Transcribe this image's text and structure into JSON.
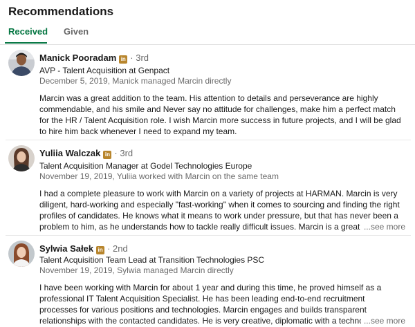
{
  "section": {
    "title": "Recommendations"
  },
  "tabs": [
    {
      "label": "Received",
      "active": true
    },
    {
      "label": "Given",
      "active": false
    }
  ],
  "recommendations": [
    {
      "name": "Manick Pooradam",
      "badge": "in",
      "degree": "3rd",
      "headline": "AVP - Talent Acquisition at Genpact",
      "meta": "December 5, 2019, Manick managed Marcin directly",
      "text": "Marcin was a great addition to the team. His attention to details and perseverance are highly commendable, and his smile and Never say no attitude for challenges, make him a perfect match for the HR / Talent Acquisition role. I wish Marcin more success in future projects, and I will be glad to hire him back whenever I need to expand my team.",
      "see_more": ""
    },
    {
      "name": "Yuliia Walczak",
      "badge": "in",
      "degree": "3rd",
      "headline": "Talent Acquisition Manager at Godel Technologies Europe",
      "meta": "November 19, 2019, Yuliia worked with Marcin on the same team",
      "text": "I had a complete pleasure to work with Marcin on a variety of projects at HARMAN. Marcin is very diligent, hard-working and especially \"fast-working\" when it comes to sourcing and finding the right profiles of candidates. He knows what it means to work under pressure, but that has never been a problem to him, as he understands how to tackle really difficult issues. Marcin is a great team",
      "see_more": "...see more"
    },
    {
      "name": "Sylwia Sałek",
      "badge": "in",
      "degree": "2nd",
      "headline": "Talent Acquisition Team Lead at Transition Technologies PSC",
      "meta": "November 19, 2019, Sylwia managed Marcin directly",
      "text": "I have been working with Marcin for about 1 year and during this time, he proved himself as a professional IT Talent Acquisition Specialist. He has been leading end-to-end recruitment processes for various positions and technologies. Marcin engages and builds transparent relationships with the contacted candidates. He is very creative, diplomatic with a technology jam person. I could de",
      "see_more": "...see more"
    }
  ],
  "colors": {
    "accent_green": "#057642",
    "badge_gold": "#b8862e"
  }
}
